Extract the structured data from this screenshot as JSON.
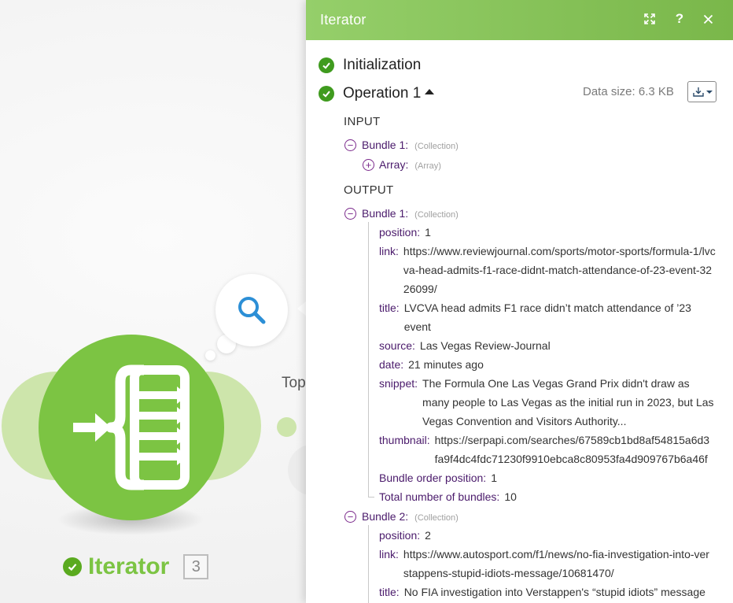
{
  "canvas": {
    "module": {
      "name": "Iterator",
      "id": "3"
    },
    "next_module_label": "Top"
  },
  "panel": {
    "title": "Iterator",
    "initialization": "Initialization",
    "operation": "Operation 1",
    "data_size": "Data size: 6.3 KB",
    "input_label": "INPUT",
    "output_label": "OUTPUT",
    "input": {
      "bundle": {
        "key": "Bundle 1:",
        "type": "(Collection)"
      },
      "array": {
        "key": "Array:",
        "type": "(Array)"
      }
    },
    "output": {
      "bundle1": {
        "key": "Bundle 1:",
        "type": "(Collection)",
        "position": {
          "key": "position:",
          "val": "1"
        },
        "link": {
          "key": "link:",
          "val": "https://www.reviewjournal.com/sports/motor-sports/formula-1/lvcva-head-admits-f1-race-didnt-match-attendance-of-23-event-3226099/"
        },
        "title": {
          "key": "title:",
          "val": "LVCVA head admits F1 race didn’t match attendance of ’23 event"
        },
        "source": {
          "key": "source:",
          "val": "Las Vegas Review-Journal"
        },
        "date": {
          "key": "date:",
          "val": "21 minutes ago"
        },
        "snippet": {
          "key": "snippet:",
          "val": "The Formula One Las Vegas Grand Prix didn't draw as many people to Las Vegas as the initial run in 2023, but Las Vegas Convention and Visitors Authority..."
        },
        "thumbnail": {
          "key": "thumbnail:",
          "val_line1": "https://serpapi.com/searches/67589cb1bd8af54815a6d3",
          "val_line2": "fa9f4dc4fdc71230f9910ebca8c80953fa4d909767b6a46f"
        },
        "order": {
          "key": "Bundle order position:",
          "val": "1"
        },
        "total": {
          "key": "Total number of bundles:",
          "val": "10"
        }
      },
      "bundle2": {
        "key": "Bundle 2:",
        "type": "(Collection)",
        "position": {
          "key": "position:",
          "val": "2"
        },
        "link": {
          "key": "link:",
          "val": "https://www.autosport.com/f1/news/no-fia-investigation-into-verstappens-stupid-idiots-message/10681470/"
        },
        "title": {
          "key": "title:",
          "val": "No FIA investigation into Verstappen's “stupid idiots” message"
        }
      }
    }
  },
  "colors": {
    "brand_green": "#7cc443",
    "check_green": "#3f9b1e",
    "key_purple": "#4a1a6b"
  }
}
